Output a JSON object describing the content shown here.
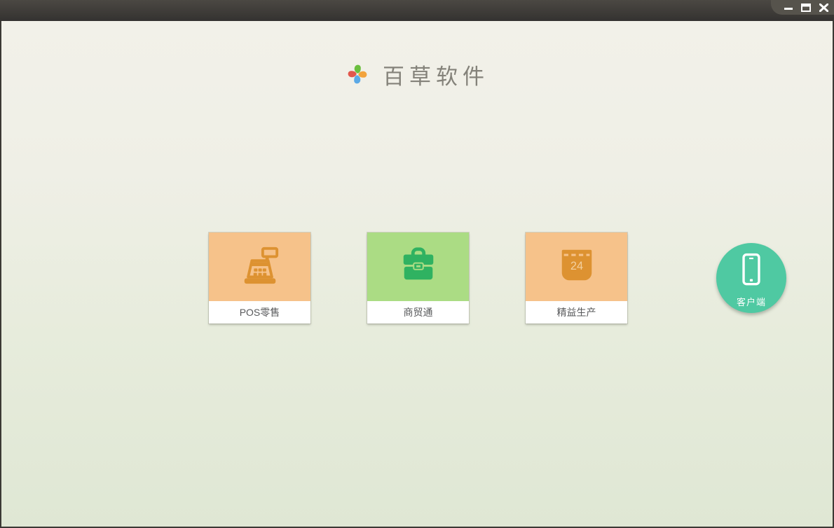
{
  "window": {
    "controls": [
      {
        "name": "minimize"
      },
      {
        "name": "maximize"
      },
      {
        "name": "close"
      }
    ]
  },
  "header": {
    "app_name": "百草软件",
    "logo": "pinwheel-logo"
  },
  "products": [
    {
      "label": "POS零售",
      "icon": "cash-register-icon"
    },
    {
      "label": "商贸通",
      "icon": "briefcase-icon"
    },
    {
      "label": "精益生产",
      "icon": "calendar-icon",
      "calendar_day": "24"
    }
  ],
  "client_button": {
    "label": "客户端",
    "icon": "smartphone-icon"
  },
  "colors": {
    "titlebar_top": "#4b4843",
    "titlebar_bottom": "#343230",
    "controls_tab": "#56534c",
    "bg_top": "#f2f1e9",
    "bg_bottom": "#dfe7d4",
    "orange_card_bg": "#f6c28a",
    "orange_icon": "#dd9231",
    "green_card_bg": "#abdc84",
    "green_icon": "#2fb261",
    "teal_circle": "#4fc9a2",
    "label_text": "#57585a",
    "logo_text": "#84827a"
  }
}
